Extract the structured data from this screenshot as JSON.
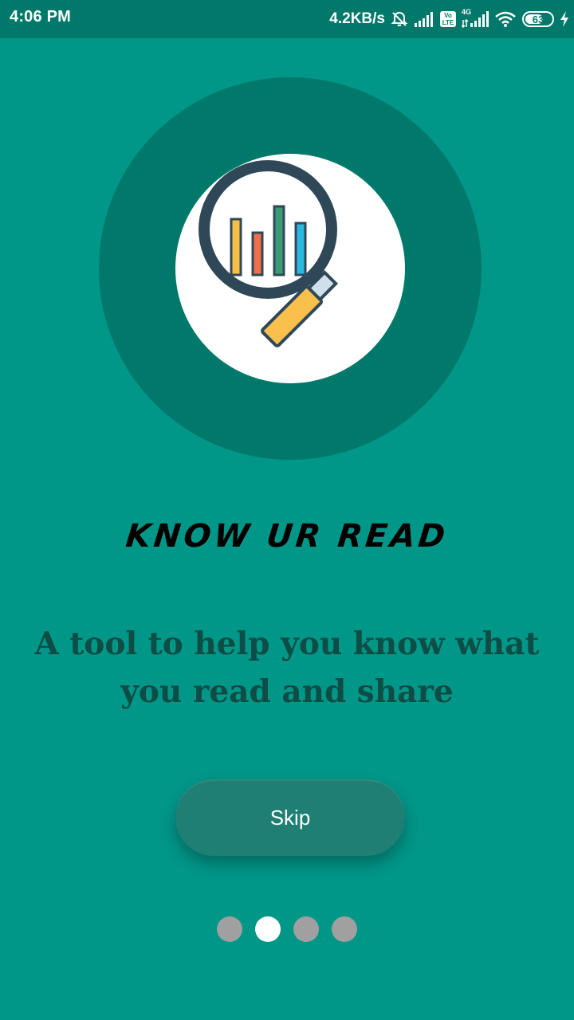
{
  "status_bar": {
    "time": "4:06 PM",
    "network_speed": "4.2KB/s",
    "volte_top": "Vo",
    "volte_bottom": "LTE",
    "network_type": "4G",
    "battery_level": "63",
    "icons": [
      "mute-alarm-icon",
      "signal-icon",
      "volte-icon",
      "signal-4g-icon",
      "wifi-icon",
      "battery-icon",
      "charging-icon"
    ]
  },
  "hero": {
    "icon": "magnifier-chart-icon",
    "colors": {
      "outer_circle": "#00796b",
      "inner_circle": "#ffffff",
      "lens_ring": "#2f4858",
      "handle": "#f9c04e",
      "bars": [
        "#f6c047",
        "#ef6f4c",
        "#3c9a75",
        "#2cb7e0"
      ]
    }
  },
  "onboarding": {
    "headline": "know ur read",
    "subtitle": "A tool to help you know what you read and share",
    "skip_label": "Skip",
    "page_count": 4,
    "active_page": 2
  },
  "colors": {
    "background": "#009688",
    "status_bar": "#00796b",
    "dot_inactive": "#a0a0a0",
    "dot_active": "#ffffff"
  }
}
